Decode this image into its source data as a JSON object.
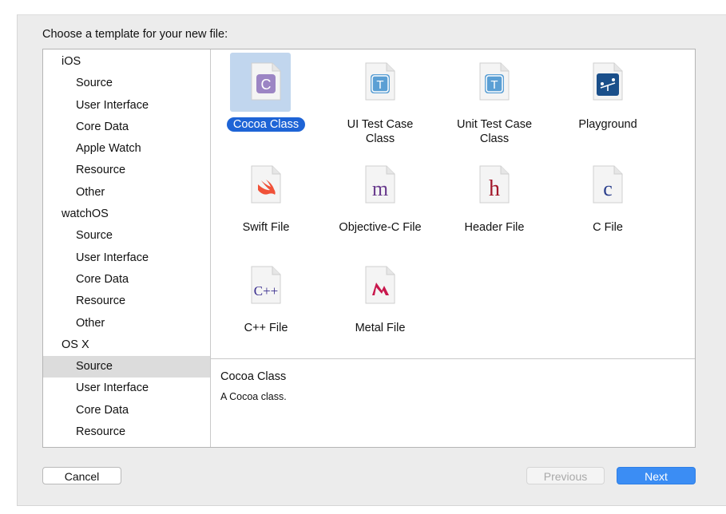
{
  "heading": "Choose a template for your new file:",
  "sidebar": {
    "groups": [
      {
        "label": "iOS",
        "items": [
          "Source",
          "User Interface",
          "Core Data",
          "Apple Watch",
          "Resource",
          "Other"
        ]
      },
      {
        "label": "watchOS",
        "items": [
          "Source",
          "User Interface",
          "Core Data",
          "Resource",
          "Other"
        ]
      },
      {
        "label": "OS X",
        "items": [
          "Source",
          "User Interface",
          "Core Data",
          "Resource"
        ]
      }
    ],
    "selected": "OS X / Source"
  },
  "templates": [
    {
      "name": "Cocoa Class",
      "icon": "cocoa-class-icon",
      "glyph": "C",
      "selected": true
    },
    {
      "name": "UI Test Case Class",
      "icon": "ui-test-case-icon",
      "glyph": "T"
    },
    {
      "name": "Unit Test Case Class",
      "icon": "unit-test-case-icon",
      "glyph": "T"
    },
    {
      "name": "Playground",
      "icon": "playground-icon",
      "glyph": ""
    },
    {
      "name": "Swift File",
      "icon": "swift-file-icon",
      "glyph": ""
    },
    {
      "name": "Objective-C File",
      "icon": "objective-c-file-icon",
      "glyph": "m"
    },
    {
      "name": "Header File",
      "icon": "header-file-icon",
      "glyph": "h"
    },
    {
      "name": "C File",
      "icon": "c-file-icon",
      "glyph": "c"
    },
    {
      "name": "C++ File",
      "icon": "cpp-file-icon",
      "glyph": "C++"
    },
    {
      "name": "Metal File",
      "icon": "metal-file-icon",
      "glyph": ""
    }
  ],
  "description": {
    "title": "Cocoa Class",
    "body": "A Cocoa class."
  },
  "buttons": {
    "cancel": "Cancel",
    "previous": "Previous",
    "next": "Next"
  },
  "colors": {
    "accent": "#1e64d6",
    "next_button": "#3b8df4",
    "selection_highlight": "#c1d6ee"
  }
}
